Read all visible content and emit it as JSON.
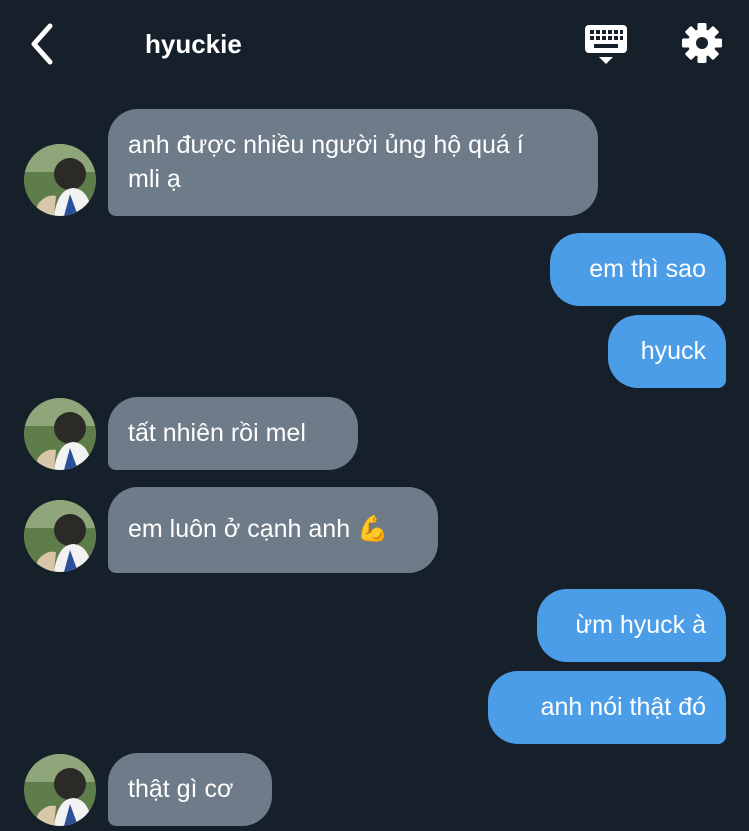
{
  "header": {
    "title": "hyuckie",
    "back_icon": "chevron-left-icon",
    "keyboard_icon": "keyboard-icon",
    "settings_icon": "gear-icon"
  },
  "colors": {
    "background": "#16202b",
    "incoming_bubble": "#6e7b88",
    "outgoing_bubble": "#4c9de8",
    "text": "#ffffff"
  },
  "messages": [
    {
      "direction": "incoming",
      "lines": [
        "anh được nhiều người ủng hộ quá í",
        "mli ạ"
      ]
    },
    {
      "direction": "outgoing",
      "lines": [
        "em thì sao"
      ]
    },
    {
      "direction": "outgoing",
      "lines": [
        "hyuck"
      ]
    },
    {
      "direction": "incoming",
      "lines": [
        "tất nhiên rồi mel"
      ]
    },
    {
      "direction": "incoming",
      "lines": [
        "em luôn ở cạnh anh 💪"
      ]
    },
    {
      "direction": "outgoing",
      "lines": [
        "ừm hyuck à"
      ]
    },
    {
      "direction": "outgoing",
      "lines": [
        "anh nói thật đó"
      ]
    },
    {
      "direction": "incoming",
      "lines": [
        "thật gì cơ"
      ]
    }
  ]
}
